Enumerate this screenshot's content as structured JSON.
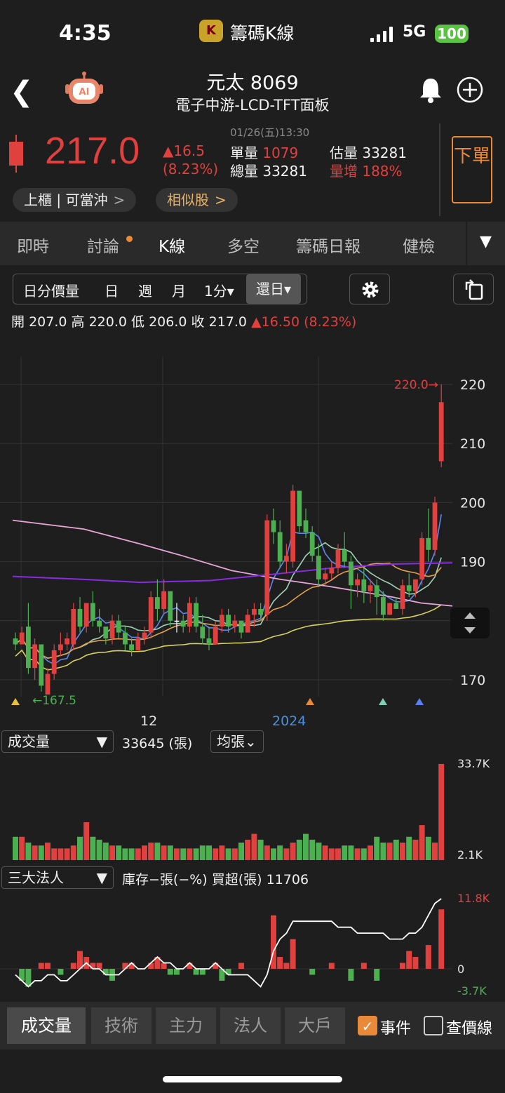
{
  "status_bar": {
    "time": "4:35",
    "app_name": "籌碼K線",
    "app_icon_glyph": "K",
    "network": "5G",
    "battery": "100"
  },
  "header": {
    "title": "元太 8069",
    "subtitle": "電子中游-LCD-TFT面板",
    "ai_badge": "AI"
  },
  "quote": {
    "price": "217.0",
    "change": "▲16.5",
    "change_pct": "(8.23%)",
    "datetime": "01/26(五)13:30",
    "single_volume_label": "單量",
    "single_volume": "1079",
    "total_volume_label": "總量",
    "total_volume": "33281",
    "est_volume_label": "估量",
    "est_volume": "33281",
    "vol_increase_label": "量增",
    "vol_increase": "188%",
    "order_button": "下單",
    "market_pill": "上櫃 | 可當沖",
    "similar_pill": "相似股",
    "up_color": "#e0413f",
    "down_color": "#4cb050"
  },
  "tabs": [
    "即時",
    "討論",
    "K線",
    "多空",
    "籌碼日報",
    "健檢"
  ],
  "toolbar": {
    "items": [
      "日分價量",
      "日",
      "週",
      "月",
      "1分▾"
    ],
    "selected": "還日▾"
  },
  "ohlc": {
    "open_label": "開",
    "open": "207.0",
    "high_label": "高",
    "high": "220.0",
    "low_label": "低",
    "low": "206.0",
    "close_label": "收",
    "close": "217.0",
    "change": "▲16.50 (8.23%)"
  },
  "price_chart": {
    "y_ticks": [
      "220",
      "210",
      "200",
      "190",
      "180",
      "170"
    ],
    "max_label": "220.0→",
    "min_label": "←167.5",
    "x_labels": [
      "12",
      "2024"
    ]
  },
  "volume_panel": {
    "selector": "成交量",
    "value": "33645 (張)",
    "mode": "均張⌄",
    "top": "33.7K",
    "bottom": "2.1K"
  },
  "institutional_panel": {
    "selector": "三大法人",
    "text": "庫存−張(−%)  買超(張) 11706",
    "top": "11.8K",
    "zero": "0",
    "bottom": "-3.7K"
  },
  "bottom_tabs": [
    "成交量",
    "技術",
    "主力",
    "法人",
    "大戶"
  ],
  "bottom_checks": {
    "event": "事件",
    "price_line": "查價線"
  },
  "chart_data": {
    "type": "candlestick",
    "ylim": [
      167,
      222
    ],
    "candles": [
      [
        177,
        178,
        175,
        176
      ],
      [
        176,
        179,
        176,
        178
      ],
      [
        179,
        183,
        171,
        172
      ],
      [
        172,
        177,
        170,
        176
      ],
      [
        176,
        176,
        168,
        169
      ],
      [
        167.5,
        172,
        167.5,
        171
      ],
      [
        171,
        176,
        170,
        175
      ],
      [
        175,
        178,
        174,
        176
      ],
      [
        176,
        178,
        175,
        177
      ],
      [
        176,
        183,
        175,
        182
      ],
      [
        182,
        184,
        178,
        179
      ],
      [
        179,
        183,
        178,
        183
      ],
      [
        183,
        185,
        179,
        180
      ],
      [
        180,
        182,
        178,
        179
      ],
      [
        179,
        179,
        176,
        177
      ],
      [
        177,
        181,
        176,
        180
      ],
      [
        180,
        181,
        177,
        178
      ],
      [
        178,
        179,
        175,
        176
      ],
      [
        176,
        177,
        174,
        175
      ],
      [
        175,
        178,
        175,
        177
      ],
      [
        177,
        179,
        176,
        178
      ],
      [
        178,
        185,
        177,
        184
      ],
      [
        184,
        187,
        180,
        182
      ],
      [
        182,
        187,
        181,
        185
      ],
      [
        185,
        184,
        179,
        180
      ],
      [
        180,
        183,
        178,
        180
      ],
      [
        180,
        181,
        178,
        179
      ],
      [
        179,
        184,
        178,
        183
      ],
      [
        183,
        184,
        178,
        179
      ],
      [
        179,
        181,
        176,
        177
      ],
      [
        177,
        179,
        175,
        176
      ],
      [
        176,
        180,
        176,
        179
      ],
      [
        179,
        182,
        178,
        181
      ],
      [
        181,
        182,
        178,
        179
      ],
      [
        179,
        181,
        178,
        180
      ],
      [
        180,
        180,
        177,
        178
      ],
      [
        178,
        182,
        178,
        181
      ],
      [
        181,
        183,
        179,
        182
      ],
      [
        182,
        183,
        180,
        181
      ],
      [
        181,
        198,
        180,
        197
      ],
      [
        197,
        199,
        193,
        195
      ],
      [
        195,
        197,
        189,
        190
      ],
      [
        190,
        193,
        188,
        191
      ],
      [
        190,
        203,
        189,
        202
      ],
      [
        202,
        201,
        195,
        196
      ],
      [
        197,
        199,
        194,
        195
      ],
      [
        195,
        196,
        190,
        191
      ],
      [
        191,
        193,
        186,
        187
      ],
      [
        187,
        189,
        186,
        188
      ],
      [
        188,
        190,
        187,
        189
      ],
      [
        189,
        193,
        188,
        192
      ],
      [
        192,
        195,
        189,
        190
      ],
      [
        190,
        191,
        182,
        186
      ],
      [
        186,
        188,
        184,
        187
      ],
      [
        187,
        189,
        183,
        185
      ],
      [
        185,
        187,
        183,
        186
      ],
      [
        186,
        187,
        181,
        184
      ],
      [
        184,
        185,
        180,
        181
      ],
      [
        181,
        183,
        181,
        183
      ],
      [
        183,
        184,
        182,
        182
      ],
      [
        182,
        187,
        181,
        186
      ],
      [
        186,
        188,
        184,
        185
      ],
      [
        185,
        187,
        184,
        187
      ],
      [
        187,
        195,
        186,
        194
      ],
      [
        194,
        199,
        190,
        192
      ],
      [
        192,
        201,
        191,
        200
      ],
      [
        207,
        220,
        206,
        217
      ]
    ],
    "volume": {
      "ylim": [
        2.1,
        33.7
      ],
      "values": [
        8,
        8,
        6,
        5,
        5,
        6,
        4,
        4,
        4,
        5,
        8,
        13,
        8,
        7,
        6,
        5,
        5,
        4,
        4,
        4,
        5,
        6,
        6,
        5,
        5,
        4,
        4,
        4,
        4,
        5,
        5,
        4,
        5,
        4,
        4,
        6,
        7,
        9,
        7,
        5,
        4,
        5,
        4,
        6,
        7,
        9,
        7,
        6,
        5,
        4,
        4,
        5,
        5,
        4,
        4,
        5,
        8,
        6,
        6,
        7,
        6,
        8,
        7,
        12,
        8,
        6,
        33
      ]
    },
    "institutional": {
      "ylim": [
        -3.7,
        11.8
      ],
      "bars": [
        0,
        -2,
        -3,
        0,
        1,
        1,
        0,
        -1,
        0,
        1,
        3,
        2,
        1,
        1,
        -1,
        -2,
        0,
        1,
        1,
        0,
        0,
        1,
        2,
        1,
        -1,
        -1,
        0,
        1,
        -1,
        -1,
        0,
        1,
        -2,
        -1,
        0,
        1,
        0,
        0,
        0,
        0,
        9,
        2,
        1,
        5,
        0,
        0,
        -1,
        0,
        0,
        1,
        0,
        0,
        -2,
        0,
        1,
        0,
        -2,
        0,
        0,
        0,
        1,
        3,
        2,
        0,
        4,
        0,
        10
      ],
      "line": [
        -1,
        -2,
        -3,
        -2,
        -2,
        -1,
        -1,
        -2,
        -2,
        -1,
        0,
        1,
        0,
        0,
        -1,
        -1,
        -1,
        0,
        1,
        0,
        0,
        1,
        2,
        1,
        1,
        0,
        0,
        1,
        0,
        0,
        0,
        1,
        0,
        -1,
        -1,
        -1,
        -1,
        -2,
        -3,
        -1,
        3,
        5,
        6,
        8,
        8,
        8,
        8,
        8,
        8,
        8,
        7,
        7,
        7,
        6,
        6,
        6,
        6,
        6,
        5,
        5,
        5,
        6,
        6,
        7,
        9,
        11,
        11.8
      ]
    }
  }
}
